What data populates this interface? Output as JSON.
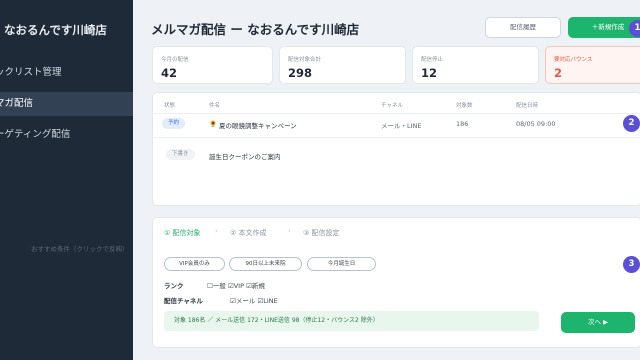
{
  "sidebar": {
    "brand": "なおるんです川崎店",
    "items": [
      {
        "label": "ックリスト管理"
      },
      {
        "label": "マガ配信"
      },
      {
        "label": "ーゲティング配信"
      }
    ]
  },
  "header": {
    "title": "メルマガ配信 ー なおるんです川崎店",
    "history_button": "配信履歴",
    "new_button": "＋新規作成"
  },
  "stats": [
    {
      "label": "今月の配信",
      "value": "42"
    },
    {
      "label": "配信対象合計",
      "value": "298"
    },
    {
      "label": "配信停止",
      "value": "12"
    },
    {
      "label": "要対応バウンス",
      "value": "2"
    }
  ],
  "table": {
    "headers": [
      "状態",
      "件名",
      "チャネル",
      "対象数",
      "配信日時"
    ],
    "rows": [
      {
        "status": "予約",
        "icon": "🌻",
        "subject": "夏の眼鏡調整キャンペーン",
        "channel": "メール・LINE",
        "count": "186",
        "date": "08/05 09:00"
      },
      {
        "status": "下書き",
        "subject": "誕生日クーポンのご案内",
        "channel": "",
        "count": "",
        "date": ""
      }
    ]
  },
  "wizard": {
    "steps": [
      "① 配信対象",
      "② 本文作成",
      "③ 配信設定"
    ],
    "separator": "›",
    "hint": "おすすめ条件（クリックで反映）",
    "chips": [
      "VIP会員のみ",
      "90日以上未来院",
      "今月誕生日"
    ],
    "rank_label": "ランク",
    "rank_options": "☐一般 ☑VIP ☑新規",
    "channel_label": "配信チャネル",
    "channel_options": "☑メール ☑LINE",
    "summary": "対象 186名 ／ メール送信 172・LINE送信 98（停止12・バウンス2 除外）",
    "next_button": "次へ ▶"
  },
  "markers": [
    "1",
    "2",
    "3"
  ],
  "colors": {
    "accent": "#1db56d",
    "sidebar": "#1f2a38",
    "warning": "#e05a45",
    "marker": "#5b4fd6"
  }
}
